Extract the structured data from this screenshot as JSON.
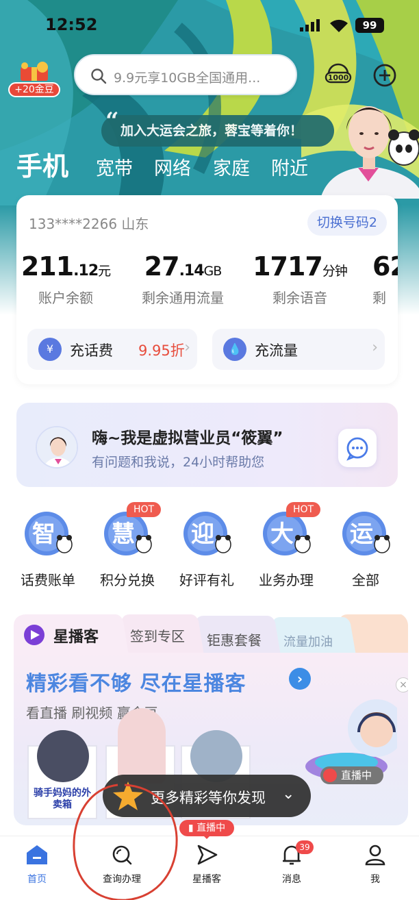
{
  "status": {
    "time": "12:52",
    "battery": "99"
  },
  "header": {
    "coin_badge": "+20金豆",
    "search_placeholder": "9.9元享10GB全国通用...",
    "slogan": "加入大运会之旅，蓉宝等着你！",
    "tabs": [
      {
        "label": "手机",
        "active": true
      },
      {
        "label": "宽带"
      },
      {
        "label": "网络"
      },
      {
        "label": "家庭"
      },
      {
        "label": "附近"
      }
    ]
  },
  "account": {
    "phone": "133****2266 山东",
    "switch_label": "切换号码2",
    "stats": [
      {
        "int": "211",
        "dec": ".12",
        "unit": "元",
        "label": "账户余额"
      },
      {
        "int": "27",
        "dec": ".14",
        "unit": "GB",
        "label": "剩余通用流量"
      },
      {
        "int": "1717",
        "dec": "",
        "unit": "分钟",
        "label": "剩余语音"
      },
      {
        "int": "62",
        "dec": "",
        "unit": "",
        "label": "剩"
      }
    ],
    "recharge_label": "充话费",
    "recharge_discount": "9.95折",
    "data_label": "充流量"
  },
  "assistant": {
    "title": "嗨~我是虚拟营业员“筱翼”",
    "subtitle": "有问题和我说，24小时帮助您"
  },
  "services": [
    {
      "glyph": "智",
      "label": "话费账单"
    },
    {
      "glyph": "慧",
      "label": "积分兑换",
      "hot": "HOT"
    },
    {
      "glyph": "迎",
      "label": "好评有礼"
    },
    {
      "glyph": "大",
      "label": "业务办理",
      "hot": "HOT"
    },
    {
      "glyph": "运",
      "label": "全部"
    }
  ],
  "promo": {
    "brand": "星播客",
    "tabs": [
      "签到专区",
      "钜惠套餐",
      "流量加油"
    ],
    "headline": "精彩看不够 尽在星播客",
    "sub": "看直播 刷视频 赢金豆",
    "thumb_caption": "骑手妈妈的外卖箱",
    "live_label": "直播中",
    "more": "更多精彩等你发现"
  },
  "nav": {
    "items": [
      {
        "label": "首页",
        "icon": "home-icon",
        "active": true
      },
      {
        "label": "查询办理",
        "icon": "search-icon"
      },
      {
        "label": "星播客",
        "icon": "play-icon"
      },
      {
        "label": "消息",
        "icon": "bell-icon"
      },
      {
        "label": "我",
        "icon": "user-icon"
      }
    ],
    "live_tag": "直播中",
    "message_badge": "39"
  },
  "colors": {
    "accent": "#3a73e0",
    "red": "#ef4a4a",
    "teal": "#1f6a6e"
  }
}
